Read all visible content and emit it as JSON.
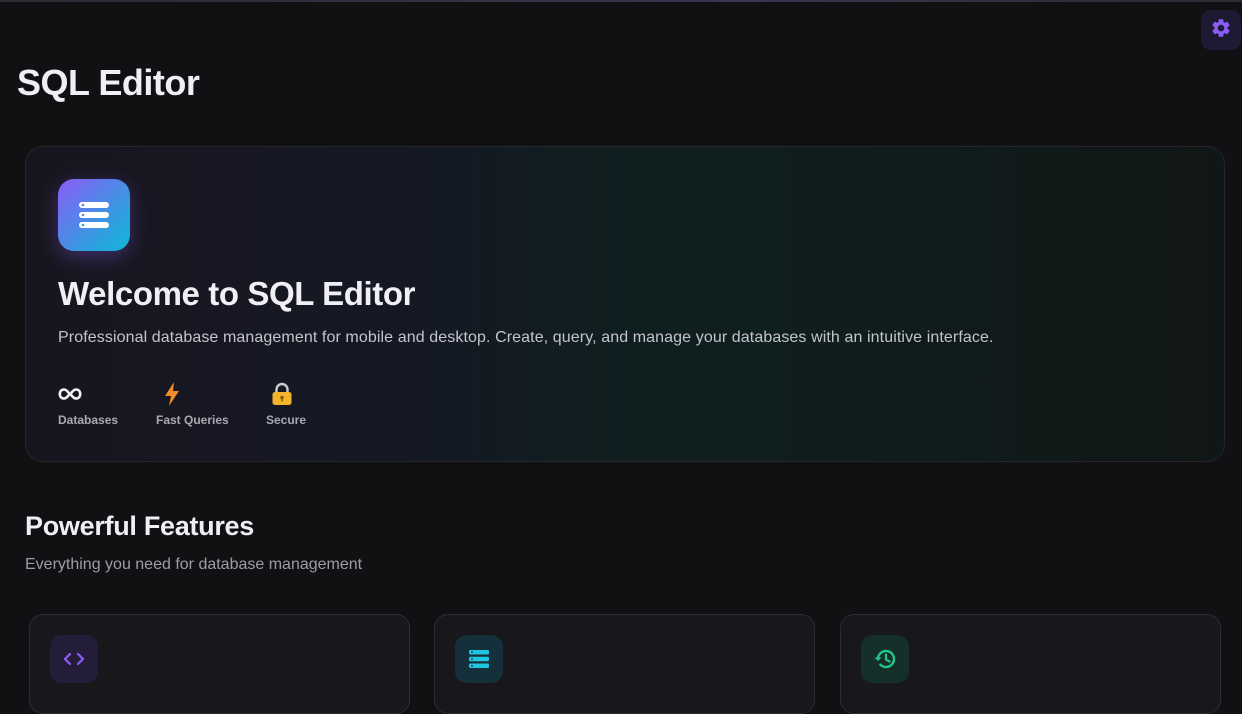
{
  "app": {
    "title": "SQL Editor"
  },
  "header": {
    "settings_icon": "gear-icon",
    "accent": "#8b5cf6"
  },
  "hero": {
    "icon": "server-stack-icon",
    "title": "Welcome to SQL Editor",
    "subtitle": "Professional database management for mobile and desktop. Create, query, and manage your databases with an intuitive interface.",
    "stats": [
      {
        "icon": "infinity-icon",
        "label": "Databases"
      },
      {
        "icon": "lightning-icon",
        "label": "Fast Queries"
      },
      {
        "icon": "lock-icon",
        "label": "Secure"
      }
    ]
  },
  "features": {
    "title": "Powerful Features",
    "subtitle": "Everything you need for database management",
    "cards": [
      {
        "icon": "code-icon",
        "color": "#8b5cf6"
      },
      {
        "icon": "database-icon",
        "color": "#22c5e0"
      },
      {
        "icon": "history-icon",
        "color": "#22c58a"
      }
    ]
  }
}
